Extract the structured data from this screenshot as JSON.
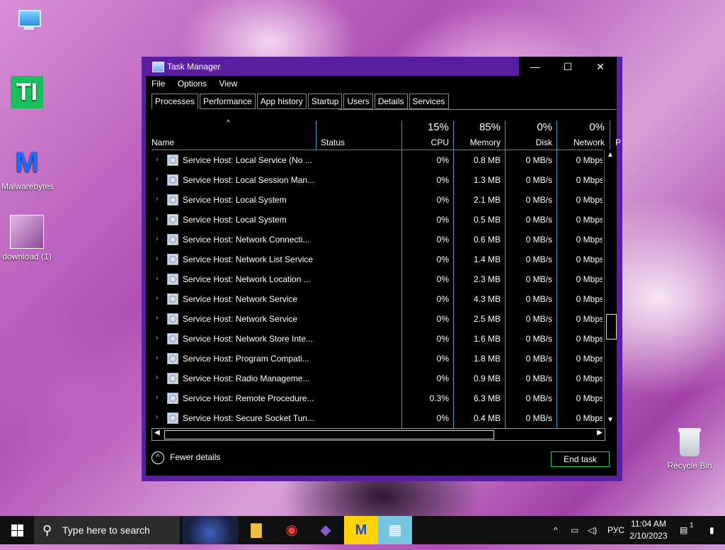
{
  "desktop": {
    "icons": [
      {
        "label": ""
      },
      {
        "label": "TI"
      },
      {
        "label": "Malwarebytes"
      },
      {
        "label": "download (1)"
      },
      {
        "label": "Recycle Bin"
      }
    ]
  },
  "window": {
    "title": "Task Manager",
    "controls": {
      "minimize": "—",
      "maximize": "☐",
      "close": "✕"
    },
    "menu": [
      "File",
      "Options",
      "View"
    ],
    "tabs": [
      "Processes",
      "Performance",
      "App history",
      "Startup",
      "Users",
      "Details",
      "Services"
    ],
    "active_tab": "Processes",
    "columns": {
      "name": "Name",
      "status": "Status",
      "cpu": {
        "pct": "15%",
        "label": "CPU"
      },
      "memory": {
        "pct": "85%",
        "label": "Memory"
      },
      "disk": {
        "pct": "0%",
        "label": "Disk"
      },
      "network": {
        "pct": "0%",
        "label": "Network"
      },
      "power": "P"
    },
    "rows": [
      {
        "name": "Service Host: Local Service (No ...",
        "cpu": "0%",
        "mem": "0.8 MB",
        "disk": "0 MB/s",
        "net": "0 Mbps"
      },
      {
        "name": "Service Host: Local Session Man...",
        "cpu": "0%",
        "mem": "1.3 MB",
        "disk": "0 MB/s",
        "net": "0 Mbps"
      },
      {
        "name": "Service Host: Local System",
        "cpu": "0%",
        "mem": "2.1 MB",
        "disk": "0 MB/s",
        "net": "0 Mbps"
      },
      {
        "name": "Service Host: Local System",
        "cpu": "0%",
        "mem": "0.5 MB",
        "disk": "0 MB/s",
        "net": "0 Mbps"
      },
      {
        "name": "Service Host: Network Connecti...",
        "cpu": "0%",
        "mem": "0.6 MB",
        "disk": "0 MB/s",
        "net": "0 Mbps"
      },
      {
        "name": "Service Host: Network List Service",
        "cpu": "0%",
        "mem": "1.4 MB",
        "disk": "0 MB/s",
        "net": "0 Mbps"
      },
      {
        "name": "Service Host: Network Location ...",
        "cpu": "0%",
        "mem": "2.3 MB",
        "disk": "0 MB/s",
        "net": "0 Mbps"
      },
      {
        "name": "Service Host: Network Service",
        "cpu": "0%",
        "mem": "4.3 MB",
        "disk": "0 MB/s",
        "net": "0 Mbps"
      },
      {
        "name": "Service Host: Network Service",
        "cpu": "0%",
        "mem": "2.5 MB",
        "disk": "0 MB/s",
        "net": "0 Mbps"
      },
      {
        "name": "Service Host: Network Store Inte...",
        "cpu": "0%",
        "mem": "1.6 MB",
        "disk": "0 MB/s",
        "net": "0 Mbps"
      },
      {
        "name": "Service Host: Program Compati...",
        "cpu": "0%",
        "mem": "1.8 MB",
        "disk": "0 MB/s",
        "net": "0 Mbps"
      },
      {
        "name": "Service Host: Radio Manageme...",
        "cpu": "0%",
        "mem": "0.9 MB",
        "disk": "0 MB/s",
        "net": "0 Mbps"
      },
      {
        "name": "Service Host: Remote Procedure...",
        "cpu": "0.3%",
        "mem": "6.3 MB",
        "disk": "0 MB/s",
        "net": "0 Mbps"
      },
      {
        "name": "Service Host: Secure Socket Tun...",
        "cpu": "0%",
        "mem": "0.4 MB",
        "disk": "0 MB/s",
        "net": "0 Mbps"
      }
    ],
    "footer": {
      "fewer_details": "Fewer details",
      "end_task": "End task"
    }
  },
  "taskbar": {
    "search_placeholder": "Type here to search",
    "language": "РУС",
    "time": "11:04 AM",
    "date": "2/10/2023",
    "notifications": "1"
  },
  "colors": {
    "window_frame": "#5a1ea0",
    "accent_line": "#2aa0c8",
    "end_task_border": "#2ecc40"
  }
}
